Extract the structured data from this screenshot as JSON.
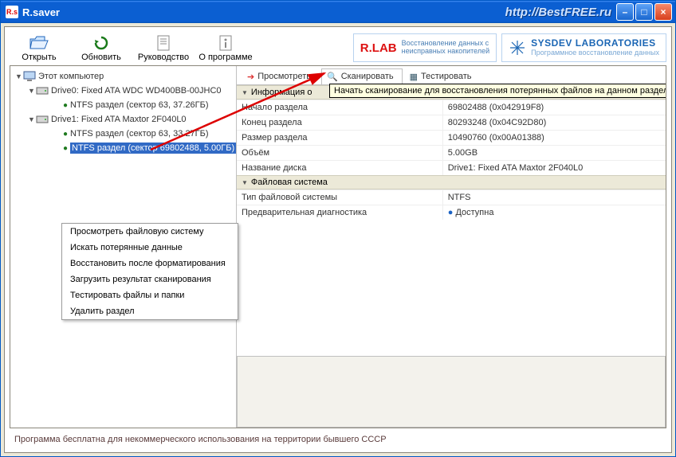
{
  "titlebar": {
    "icon_text": "R.s",
    "title": "R.saver",
    "url": "http://BestFREE.ru"
  },
  "winbuttons": {
    "min": "–",
    "max": "□",
    "close": "×"
  },
  "toolbar": {
    "open": "Открыть",
    "refresh": "Обновить",
    "manual": "Руководство",
    "about": "О программе"
  },
  "logos": {
    "rlab_name": "R.LAB",
    "rlab_sub1": "Восстановление данных с",
    "rlab_sub2": "неисправных накопителей",
    "sysdev_name": "SYSDEV LABORATORIES",
    "sysdev_sub": "Программное восстановление данных"
  },
  "tree": {
    "root": "Этот компьютер",
    "drive0": "Drive0: Fixed ATA WDC WD400BB-00JHC0",
    "d0p0": "NTFS раздел (сектор 63, 37.26ГБ)",
    "drive1": "Drive1: Fixed ATA Maxtor 2F040L0",
    "d1p0": "NTFS раздел (сектор 63, 33.27ГБ)",
    "d1p1": "NTFS раздел (сектор 69802488, 5.00ГБ)"
  },
  "context_menu": {
    "items": [
      "Просмотреть файловую систему",
      "Искать потерянные данные",
      "Восстановить после форматирования",
      "Загрузить результат сканирования",
      "Тестировать файлы и папки",
      "Удалить раздел"
    ]
  },
  "tabs": {
    "view": "Просмотреть",
    "scan": "Сканировать",
    "test": "Тестировать",
    "tooltip": "Начать сканирование для восстановления потерянных файлов на данном разделе"
  },
  "section_info": "Информация о",
  "section_fs": "Файловая система",
  "props": {
    "start_label": "Начало раздела",
    "start_val": "69802488 (0x042919F8)",
    "end_label": "Конец раздела",
    "end_val": "80293248 (0x04C92D80)",
    "size_label": "Размер раздела",
    "size_val": "10490760 (0x00A01388)",
    "vol_label": "Объём",
    "vol_val": "5.00GB",
    "disk_label": "Название диска",
    "disk_val": "Drive1: Fixed ATA Maxtor 2F040L0",
    "fstype_label": "Тип файловой системы",
    "fstype_val": "NTFS",
    "diag_label": "Предварительная диагностика",
    "diag_val": "Доступна"
  },
  "status": "Программа бесплатна для некоммерческого использования на территории бывшего СССР"
}
